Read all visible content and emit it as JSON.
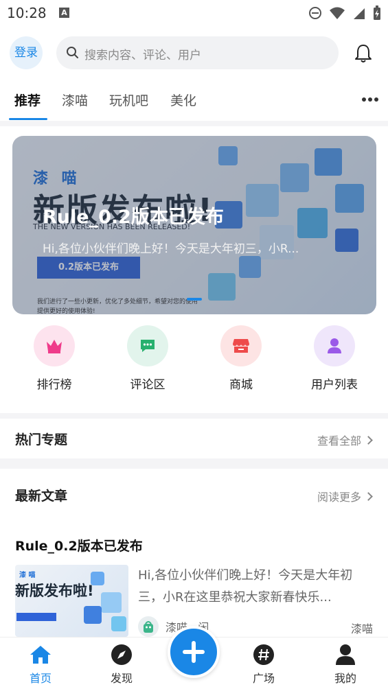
{
  "status_bar": {
    "time": "10:28",
    "notification_letter": "A"
  },
  "header": {
    "login_label": "登录",
    "search_placeholder": "搜索内容、评论、用户"
  },
  "tabs": [
    {
      "label": "推荐",
      "active": true
    },
    {
      "label": "漆喵",
      "active": false
    },
    {
      "label": "玩机吧",
      "active": false
    },
    {
      "label": "美化",
      "active": false
    }
  ],
  "banner": {
    "brand": "漆 喵",
    "headline": "新版发布啦!",
    "english": "THE NEW VERSION HAS BEEN RELEASED!",
    "badge": "0.2版本已发布",
    "small_text": "我们进行了一些小更新，优化了多处细节，希望对您的使用提供更好的使用体验!",
    "overlay_title": "Rule_0.2版本已发布",
    "overlay_subtitle": "Hi,各位小伙伴们晚上好！今天是大年初三，小R..."
  },
  "quick_links": [
    {
      "label": "排行榜",
      "icon": "crown-icon",
      "bg": "#fde3ee",
      "color": "#ef3b8a"
    },
    {
      "label": "评论区",
      "icon": "comment-icon",
      "bg": "#e2f4ec",
      "color": "#27b06e"
    },
    {
      "label": "商城",
      "icon": "shop-icon",
      "bg": "#fde4e4",
      "color": "#ee4b4b"
    },
    {
      "label": "用户列表",
      "icon": "user-icon",
      "bg": "#efe6fb",
      "color": "#9a59e8"
    }
  ],
  "hot_topics": {
    "title": "热门专题",
    "link": "查看全部"
  },
  "latest": {
    "title": "最新文章",
    "link": "阅读更多",
    "article": {
      "title": "Rule_0.2版本已发布",
      "description": "Hi,各位小伙伴们晚上好！今天是大年初三，小R在这里恭祝大家新春快乐...",
      "thumb_brand": "漆 喵",
      "thumb_headline": "新版发布啦!",
      "author": "漆喵...闲",
      "category": "漆喵"
    }
  },
  "bottom_nav": [
    {
      "label": "首页",
      "icon": "home-icon",
      "active": true
    },
    {
      "label": "发现",
      "icon": "compass-icon",
      "active": false
    },
    {
      "label": "广场",
      "icon": "hashtag-icon",
      "active": false
    },
    {
      "label": "我的",
      "icon": "profile-icon",
      "active": false
    }
  ],
  "colors": {
    "accent": "#1a87e6"
  }
}
